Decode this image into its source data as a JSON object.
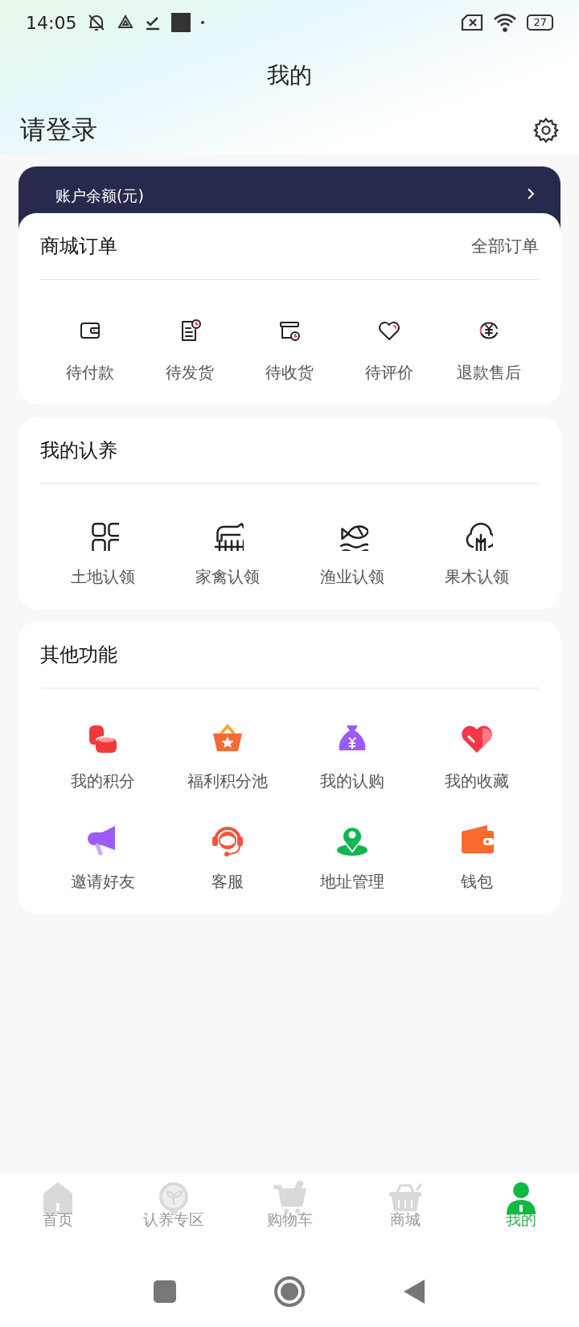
{
  "status_bar": {
    "time": "14:05",
    "battery": "27"
  },
  "header": {
    "title": "我的"
  },
  "user": {
    "login_prompt": "请登录"
  },
  "balance_card": {
    "label": "账户余额(元)"
  },
  "sections": [
    {
      "title": "商城订单",
      "link": "全部订单",
      "items": [
        {
          "label": "待付款"
        },
        {
          "label": "待发货"
        },
        {
          "label": "待收货"
        },
        {
          "label": "待评价"
        },
        {
          "label": "退款售后"
        }
      ]
    },
    {
      "title": "我的认养",
      "items": [
        {
          "label": "土地认领"
        },
        {
          "label": "家禽认领"
        },
        {
          "label": "渔业认领"
        },
        {
          "label": "果木认领"
        }
      ]
    },
    {
      "title": "其他功能",
      "items": [
        {
          "label": "我的积分"
        },
        {
          "label": "福利积分池"
        },
        {
          "label": "我的认购"
        },
        {
          "label": "我的收藏"
        },
        {
          "label": "邀请好友"
        },
        {
          "label": "客服"
        },
        {
          "label": "地址管理"
        },
        {
          "label": "钱包"
        }
      ]
    }
  ],
  "tab_bar": [
    {
      "label": "首页",
      "selected": false
    },
    {
      "label": "认养专区",
      "selected": false
    },
    {
      "label": "购物车",
      "selected": false
    },
    {
      "label": "商城",
      "selected": false
    },
    {
      "label": "我的",
      "selected": true
    }
  ]
}
